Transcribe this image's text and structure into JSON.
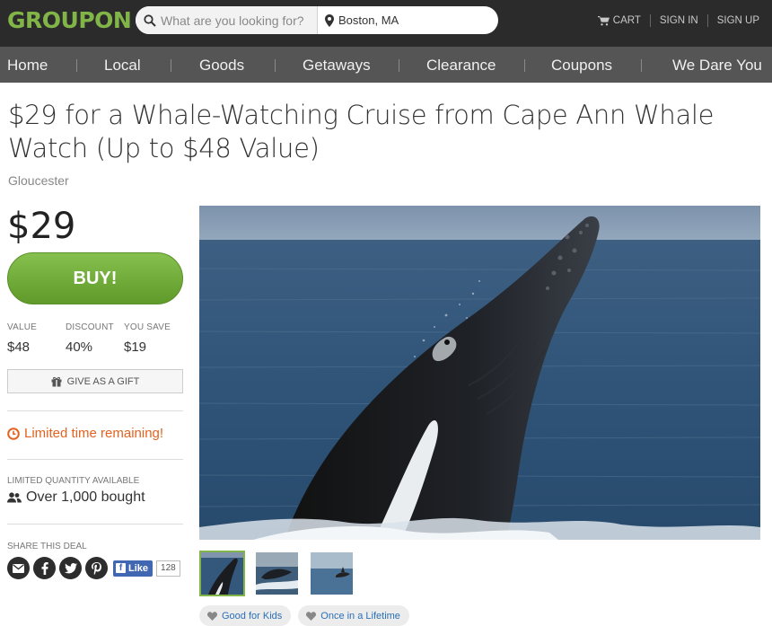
{
  "header": {
    "logo": "GROUPON",
    "search_placeholder": "What are you looking for?",
    "location": "Boston, MA",
    "cart": "CART",
    "sign_in": "SIGN IN",
    "sign_up": "SIGN UP"
  },
  "nav": [
    "Home",
    "Local",
    "Goods",
    "Getaways",
    "Clearance",
    "Coupons",
    "We Dare You"
  ],
  "deal": {
    "title": "$29 for a Whale-Watching Cruise from Cape Ann Whale Watch (Up to $48 Value)",
    "location": "Gloucester",
    "price": "$29",
    "buy_label": "BUY!",
    "stats": [
      {
        "label": "VALUE",
        "value": "$48"
      },
      {
        "label": "DISCOUNT",
        "value": "40%"
      },
      {
        "label": "YOU SAVE",
        "value": "$19"
      }
    ],
    "gift_label": "GIVE AS A GIFT",
    "limited_time": "Limited time remaining!",
    "quantity_label": "LIMITED QUANTITY AVAILABLE",
    "bought": "Over 1,000 bought",
    "share_label": "SHARE THIS DEAL",
    "fb_like": "Like",
    "fb_count": "128",
    "tags": [
      "Good for Kids",
      "Once in a Lifetime"
    ]
  },
  "colors": {
    "brand_green": "#82b548",
    "buy_green": "#6fad36",
    "alert_orange": "#e3621f",
    "nav_bg": "#555555",
    "topbar_bg": "#2b2b2b",
    "tag_link": "#2a6fb7"
  },
  "icons": {
    "search": "search-icon",
    "location": "map-pin-icon",
    "cart": "cart-icon",
    "gift": "gift-icon",
    "clock": "clock-icon",
    "users": "users-icon",
    "email": "email-icon",
    "facebook": "facebook-icon",
    "twitter": "twitter-icon",
    "pinterest": "pinterest-icon",
    "heart": "heart-icon"
  }
}
